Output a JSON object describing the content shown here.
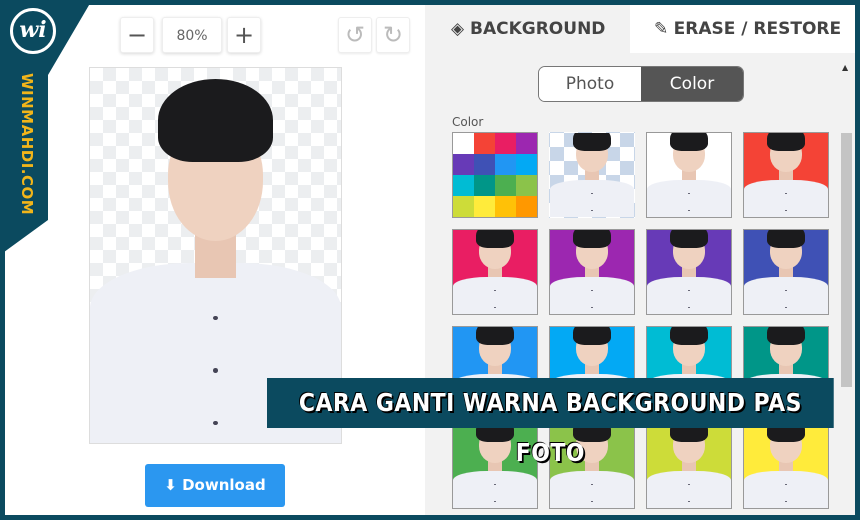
{
  "brand": {
    "logo_letter": "wi",
    "name": "WINMAHDI.COM"
  },
  "toolbar": {
    "zoom_out": "−",
    "zoom_value": "80%",
    "zoom_in": "+",
    "undo": "↺",
    "redo": "↻"
  },
  "download": {
    "icon": "download-icon",
    "label": "Download"
  },
  "tabs": [
    {
      "label": "BACKGROUND",
      "icon": "layers-icon",
      "active": true
    },
    {
      "label": "ERASE / RESTORE",
      "icon": "brush-icon",
      "active": false
    }
  ],
  "mode": {
    "options": [
      "Photo",
      "Color"
    ],
    "selected": "Color"
  },
  "color_section": {
    "label": "Color",
    "palette": [
      "#ffffff",
      "#f44336",
      "#e91e63",
      "#9c27b0",
      "#673ab7",
      "#3f51b5",
      "#2196f3",
      "#03a9f4",
      "#00bcd4",
      "#009688",
      "#4caf50",
      "#8bc34a",
      "#cddc39",
      "#ffeb3b",
      "#ffc107",
      "#ff9800"
    ],
    "swatches": [
      "transparent",
      "#ffffff",
      "#f44336",
      "#e91e63",
      "#9c27b0",
      "#673ab7",
      "#3f51b5",
      "#2196f3",
      "#03a9f4",
      "#00bcd4",
      "#009688",
      "#4caf50",
      "#8bc34a",
      "#cddc39",
      "#ffeb3b"
    ]
  },
  "banner": {
    "text": "CARA GANTI WARNA BACKGROUND PAS FOTO"
  },
  "colors": {
    "frame": "#0b4a5f",
    "accent": "#2b97f0",
    "logo_text": "#f2b51a"
  }
}
